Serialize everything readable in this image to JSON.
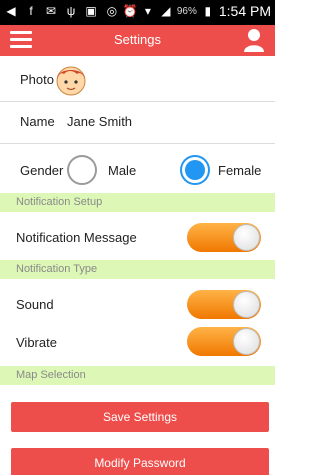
{
  "status_bar": {
    "battery_percent": "96%",
    "time": "1:54 PM"
  },
  "app_bar": {
    "title": "Settings"
  },
  "photo": {
    "label": "Photo"
  },
  "name": {
    "label": "Name",
    "value": "Jane Smith"
  },
  "gender": {
    "label": "Gender",
    "options": [
      {
        "label": "Male",
        "selected": false
      },
      {
        "label": "Female",
        "selected": true
      }
    ]
  },
  "sections": {
    "notification_setup": "Notification Setup",
    "notification_type": "Notification Type",
    "map_selection": "Map Selection"
  },
  "toggles": {
    "notification_message": {
      "label": "Notification Message",
      "on": true
    },
    "sound": {
      "label": "Sound",
      "on": true
    },
    "vibrate": {
      "label": "Vibrate",
      "on": true
    }
  },
  "buttons": {
    "save": "Save Settings",
    "modify_password": "Modify Password"
  },
  "colors": {
    "accent": "#ee4e4b",
    "section_bg": "#ddf7b6",
    "toggle_on": "#f07800",
    "radio_selected": "#2196f3"
  }
}
